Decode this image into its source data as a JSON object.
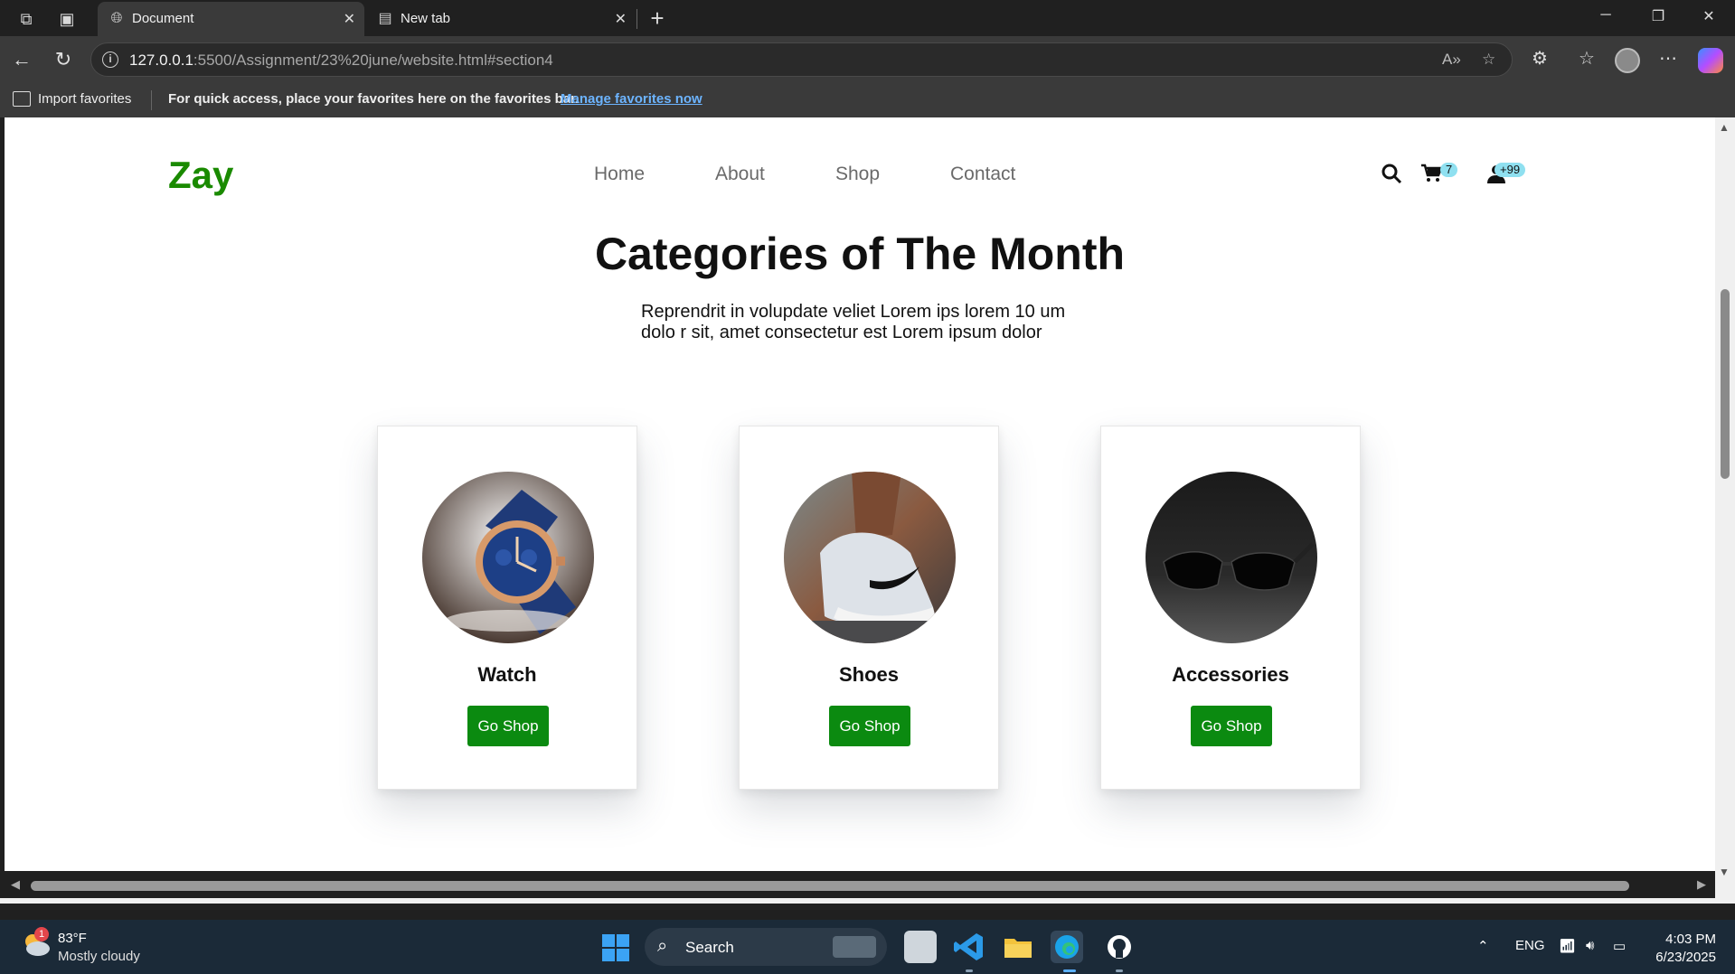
{
  "browser": {
    "tabs": [
      {
        "title": "Document",
        "active": true
      },
      {
        "title": "New tab",
        "active": false
      }
    ],
    "url_host": "127.0.0.1",
    "url_rest": ":5500/Assignment/23%20june/website.html#section4",
    "favorites_bar": {
      "import_label": "Import favorites",
      "message": "For quick access, place your favorites here on the favorites bar.",
      "link": "Manage favorites now"
    }
  },
  "site": {
    "logo": "Zay",
    "nav": [
      "Home",
      "About",
      "Shop",
      "Contact"
    ],
    "cart_count": "7",
    "user_count": "+99",
    "section": {
      "title": "Categories of The Month",
      "subtitle": "Reprendrit in volupdate veliet Lorem ips lorem 10 um dolo r sit, amet consectetur est Lorem ipsum dolor"
    },
    "categories": [
      {
        "name": "Watch",
        "button": "Go Shop"
      },
      {
        "name": "Shoes",
        "button": "Go Shop"
      },
      {
        "name": "Accessories",
        "button": "Go Shop"
      }
    ],
    "colors": {
      "brand": "#1a8a00",
      "button": "#0b8a10",
      "badge": "#8fe0f0"
    }
  },
  "taskbar": {
    "weather_temp": "83°F",
    "weather_cond": "Mostly cloudy",
    "weather_alert": "1",
    "search_label": "Search",
    "lang": "ENG",
    "time": "4:03 PM",
    "date": "6/23/2025"
  }
}
